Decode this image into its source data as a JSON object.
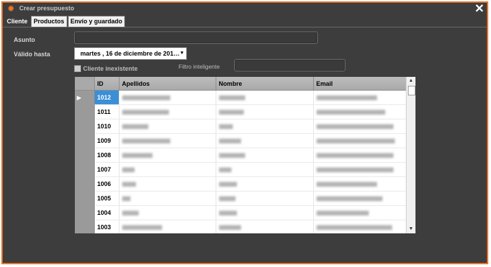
{
  "window": {
    "title": "Crear presupuesto",
    "close_label": "✕",
    "accent": "#e8762b",
    "icon": "gear-icon"
  },
  "tabs": [
    {
      "label": "Cliente"
    },
    {
      "label": "Productos"
    },
    {
      "label": "Envío y guardado"
    }
  ],
  "form": {
    "asunto_label": "Asunto",
    "asunto_value": "",
    "valido_label": "Válido hasta",
    "valido_value": "martes  , 16 de  diciembre  de 201…",
    "cliente_inexistente_label": "Cliente inexistente",
    "filtro_label": "Filtro inteligente",
    "filtro_value": ""
  },
  "table": {
    "columns": [
      "ID",
      "Apellidos",
      "Nombre",
      "Email"
    ],
    "selected_row": 0,
    "rows": [
      {
        "id": "1012",
        "apellidos_w": 70,
        "nombre_w": 38,
        "email_w": 88
      },
      {
        "id": "1011",
        "apellidos_w": 68,
        "nombre_w": 36,
        "email_w": 100
      },
      {
        "id": "1010",
        "apellidos_w": 38,
        "nombre_w": 20,
        "email_w": 112
      },
      {
        "id": "1009",
        "apellidos_w": 70,
        "nombre_w": 32,
        "email_w": 114
      },
      {
        "id": "1008",
        "apellidos_w": 44,
        "nombre_w": 38,
        "email_w": 112
      },
      {
        "id": "1007",
        "apellidos_w": 18,
        "nombre_w": 18,
        "email_w": 112
      },
      {
        "id": "1006",
        "apellidos_w": 20,
        "nombre_w": 26,
        "email_w": 88
      },
      {
        "id": "1005",
        "apellidos_w": 12,
        "nombre_w": 24,
        "email_w": 96
      },
      {
        "id": "1004",
        "apellidos_w": 24,
        "nombre_w": 26,
        "email_w": 76
      },
      {
        "id": "1003",
        "apellidos_w": 58,
        "nombre_w": 32,
        "email_w": 110
      }
    ]
  }
}
